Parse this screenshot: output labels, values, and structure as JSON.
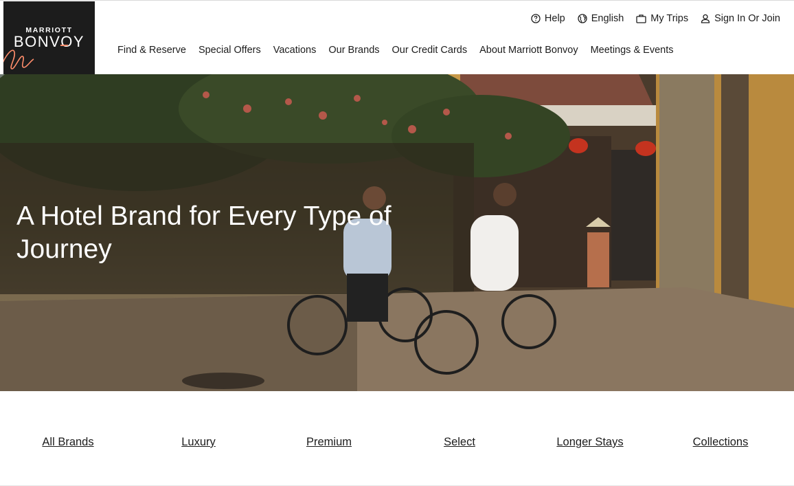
{
  "logo": {
    "line1": "MARRIOTT",
    "line2": "BONVOY"
  },
  "utility_nav": [
    {
      "label": "Help",
      "icon": "help-circle-icon"
    },
    {
      "label": "English",
      "icon": "globe-icon"
    },
    {
      "label": "My Trips",
      "icon": "suitcase-icon"
    },
    {
      "label": "Sign In Or Join",
      "icon": "user-icon"
    }
  ],
  "main_nav": [
    "Find & Reserve",
    "Special Offers",
    "Vacations",
    "Our Brands",
    "Our Credit Cards",
    "About Marriott Bonvoy",
    "Meetings & Events"
  ],
  "hero": {
    "title": "A Hotel Brand for Every Type of Journey"
  },
  "brand_tabs": [
    "All Brands",
    "Luxury",
    "Premium",
    "Select",
    "Longer Stays",
    "Collections"
  ],
  "colors": {
    "logo_bg": "#1c1c1c",
    "logo_accent": "#ff8d6b",
    "text": "#1c1c1c",
    "hero_text": "#ffffff"
  }
}
